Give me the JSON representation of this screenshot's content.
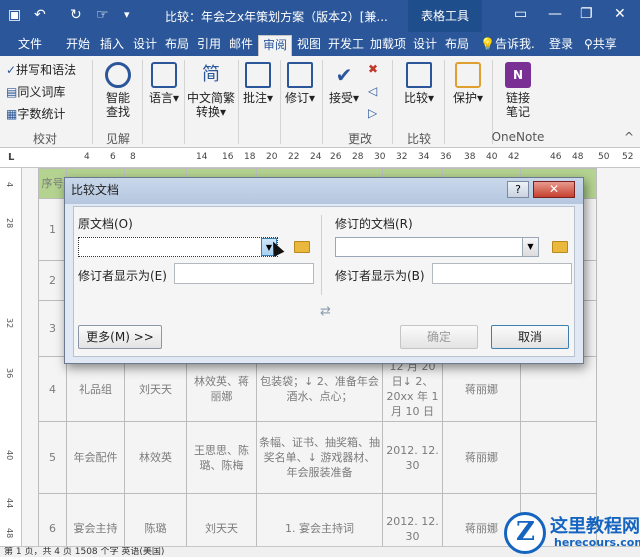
{
  "titlebar": {
    "title": "比较：年会之x年策划方案（版本2）[兼...",
    "context_tab": "表格工具",
    "icons": [
      "save-icon",
      "undo-icon",
      "redo-icon",
      "touch-mode-icon",
      "customize-qat-icon"
    ]
  },
  "tabs": [
    "文件",
    "开始",
    "插入",
    "设计",
    "布局",
    "引用",
    "邮件",
    "审阅",
    "视图",
    "开发工",
    "加载项",
    "设计",
    "布局"
  ],
  "active_tab": "审阅",
  "tellme": "告诉我.",
  "login": "登录",
  "share": "共享",
  "ribbon": {
    "proofing": {
      "items": [
        "拼写和语法",
        "同义词库",
        "字数统计"
      ],
      "group": "校对"
    },
    "insights": {
      "label_line1": "智能",
      "label_line2": "查找",
      "group": "见解"
    },
    "language": {
      "label": "语言"
    },
    "chinese": {
      "label_line1": "中文简繁",
      "label_line2": "转换"
    },
    "comments": {
      "label": "批注"
    },
    "tracking": {
      "label": "修订"
    },
    "changes": {
      "accept": "接受",
      "group": "更改"
    },
    "compare": {
      "label": "比较",
      "group": "比较"
    },
    "protect": {
      "label": "保护"
    },
    "onenote": {
      "label_line1": "链接",
      "label_line2": "笔记",
      "group": "OneNote"
    }
  },
  "ruler": {
    "h_labels": [
      "L",
      "4",
      "6",
      "8",
      "14",
      "16",
      "18",
      "20",
      "22",
      "24",
      "26",
      "28",
      "30",
      "32",
      "34",
      "36",
      "38",
      "40",
      "42",
      "46",
      "48",
      "50",
      "52"
    ],
    "v_labels": [
      "4",
      "28",
      "32",
      "36",
      "40",
      "44",
      "48"
    ]
  },
  "table": {
    "rows": [
      {
        "no": "序号",
        "c1": "",
        "c2": "",
        "c3": "",
        "c4": "",
        "c5": "",
        "c6": "",
        "c7": ""
      },
      {
        "no": "1",
        "c1": "",
        "c2": "",
        "c3": "",
        "c4": "",
        "c5": "",
        "c6": "",
        "c7": ""
      },
      {
        "no": "2",
        "c1": "",
        "c2": "",
        "c3": "",
        "c4": "",
        "c5": "",
        "c6": "",
        "c7": ""
      },
      {
        "no": "3",
        "c1": "",
        "c2": "",
        "c3": "",
        "c4": "",
        "c5": "",
        "c6": "",
        "c7": ""
      },
      {
        "no": "4",
        "c1": "礼品组",
        "c2": "刘天天",
        "c3": "林效英、蒋丽娜",
        "c4": "包装袋；↓ 2、准备年会酒水、点心；",
        "c5": "12 月 20 日↓ 2、20xx 年 1 月 10 日",
        "c6": "蒋丽娜",
        "c7": ""
      },
      {
        "no": "5",
        "c1": "年会配件",
        "c2": "林效英",
        "c3": "王思思、陈璐、陈梅",
        "c4": "条幅、证书、抽奖箱、抽奖名单、↓ 游戏器材、年会服装准备",
        "c5": "2012. 12. 30",
        "c6": "蒋丽娜",
        "c7": ""
      },
      {
        "no": "6",
        "c1": "宴会主持",
        "c2": "陈璐",
        "c3": "刘天天",
        "c4": "1. 宴会主持词",
        "c5": "2012. 12. 30",
        "c6": "蒋丽娜",
        "c7": ""
      }
    ]
  },
  "status": {
    "text": "第 1 页，共 4 页    1508 个字    英语(美国)"
  },
  "dialog": {
    "title": "比较文档",
    "original_label": "原文档(O)",
    "original_value": "",
    "original_reviewer_label": "修订者显示为(E)",
    "original_reviewer_value": "",
    "revised_label": "修订的文档(R)",
    "revised_value": "",
    "revised_reviewer_label": "修订者显示为(B)",
    "revised_reviewer_value": "",
    "more_button": "更多(M) >>",
    "ok_button": "确定",
    "cancel_button": "取消",
    "help_button": "?",
    "close_button": "✕"
  },
  "watermark": {
    "cn": "这里教程网",
    "en": "herecours.com"
  }
}
